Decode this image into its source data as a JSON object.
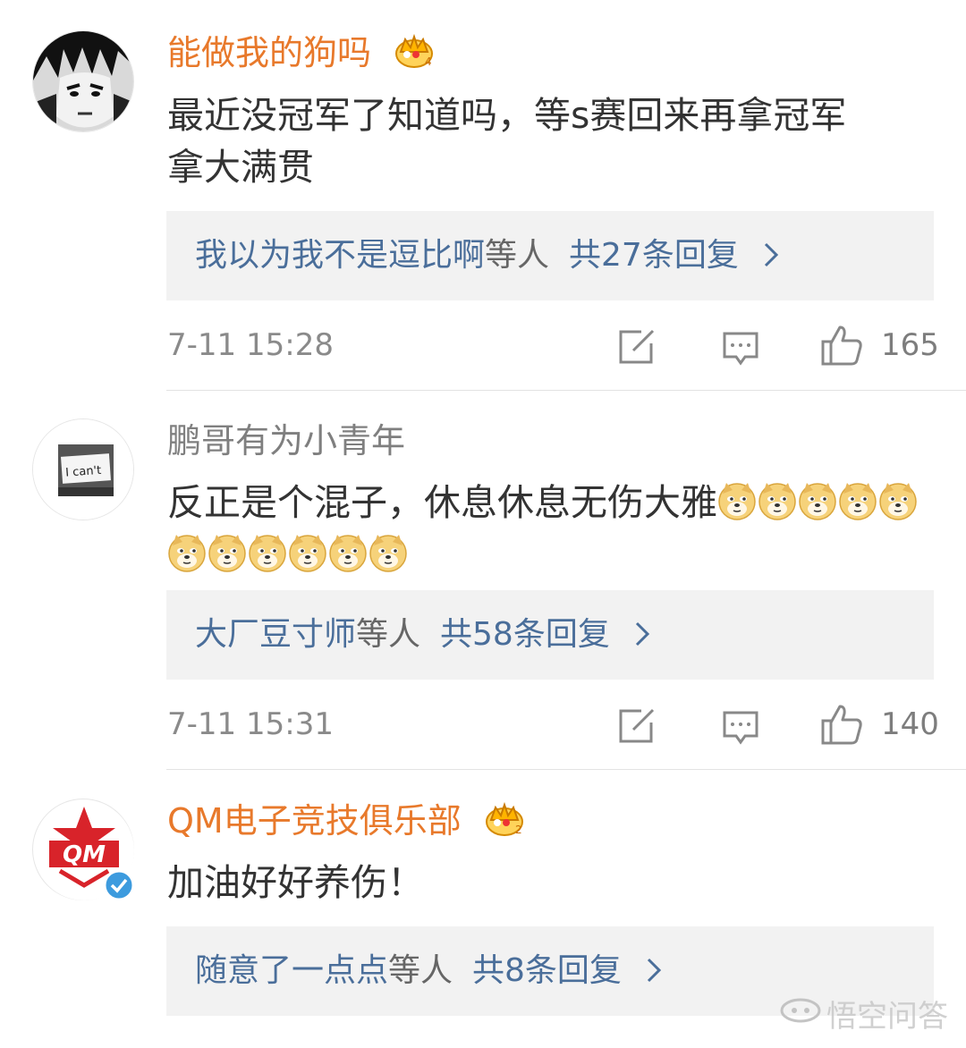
{
  "comments": [
    {
      "username": "能做我的狗吗",
      "text_line1": "最近没冠军了知道吗，等s赛回来再拿冠军",
      "text_line2": "拿大满贯",
      "reply_names": "我以为我不是逗比啊",
      "reply_mid": "等人",
      "reply_count": "共27条回复",
      "time": "7-11 15:28",
      "likes": "165",
      "avatar_icon": "manga-avatar",
      "badge_icon": "crown-icon"
    },
    {
      "username": "鹏哥有为小青年",
      "text": "反正是个混子，休息休息无伤大雅",
      "emoji_count": 11,
      "reply_names": "大厂豆寸师",
      "reply_mid": "等人",
      "reply_count": "共58条回复",
      "time": "7-11 15:31",
      "likes": "140",
      "avatar_text": "I can't",
      "avatar_icon": "i-cant-sign-avatar"
    },
    {
      "username": "QM电子竞技俱乐部",
      "text": "加油好好养伤！",
      "reply_names": "随意了一点点",
      "reply_mid": "等人",
      "reply_count": "共8条回复",
      "avatar_text": "QM",
      "avatar_icon": "qm-logo-avatar",
      "badge_icon": "crown-icon",
      "verified_icon": "verified-check-icon"
    }
  ],
  "watermark": "悟空问答",
  "colors": {
    "vip_name": "#e8792b",
    "link_blue": "#4a6e9a",
    "reply_bg": "#f2f2f2"
  }
}
